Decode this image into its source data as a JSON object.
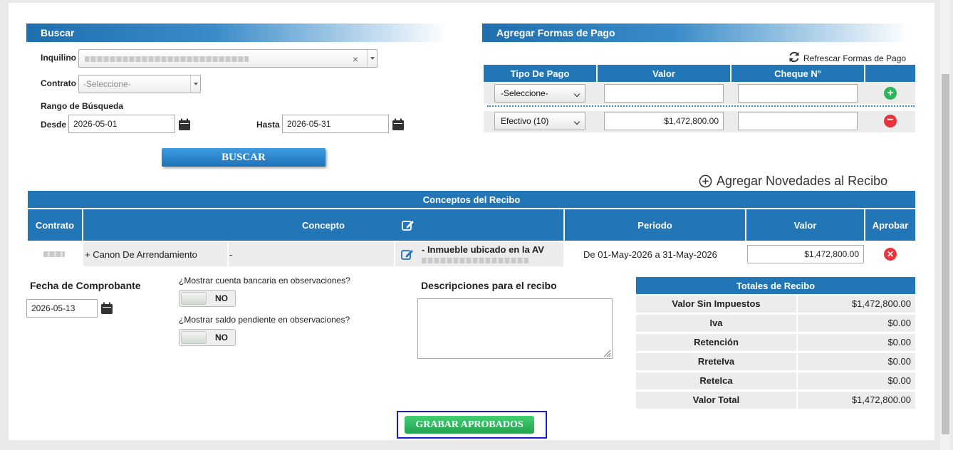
{
  "buscar": {
    "title": "Buscar",
    "inquilino_label": "Inquilino",
    "contrato_label": "Contrato",
    "contrato_placeholder": "-Seleccione-",
    "rango_label": "Rango de Búsqueda",
    "desde_label": "Desde",
    "desde_value": "2026-05-01",
    "hasta_label": "Hasta",
    "hasta_value": "2026-05-31",
    "button": "BUSCAR"
  },
  "pagos": {
    "title": "Agregar Formas de Pago",
    "refresh": "Refrescar Formas de Pago",
    "headers": [
      "Tipo De Pago",
      "Valor",
      "Cheque N°"
    ],
    "new_row_select": "-Seleccione-",
    "row": {
      "tipo": "Efectivo (10)",
      "valor": "$1,472,800.00",
      "cheque": ""
    }
  },
  "novedades": {
    "label": "Agregar Novedades al Recibo"
  },
  "conceptos": {
    "title": "Conceptos del Recibo",
    "headers": {
      "contrato": "Contrato",
      "concepto": "Concepto",
      "periodo": "Periodo",
      "valor": "Valor",
      "aprobar": "Aprobar"
    },
    "row": {
      "concepto": "+ Canon De Arrendamiento",
      "detalle": "-",
      "descripcion": "- Inmueble ubicado en la AV",
      "periodo": "De 01-May-2026 a 31-May-2026",
      "valor": "$1,472,800.00"
    }
  },
  "comprobante": {
    "label": "Fecha de Comprobante",
    "value": "2026-05-13"
  },
  "toggles": [
    {
      "question": "¿Mostrar cuenta bancaria en observaciones?",
      "state": "NO"
    },
    {
      "question": "¿Mostrar saldo pendiente en observaciones?",
      "state": "NO"
    }
  ],
  "descripciones": {
    "label": "Descripciones para el recibo",
    "value": ""
  },
  "totales": {
    "title": "Totales de Recibo",
    "rows": [
      {
        "label": "Valor Sin Impuestos",
        "value": "$1,472,800.00"
      },
      {
        "label": "Iva",
        "value": "$0.00"
      },
      {
        "label": "Retención",
        "value": "$0.00"
      },
      {
        "label": "RreteIva",
        "value": "$0.00"
      },
      {
        "label": "ReteIca",
        "value": "$0.00"
      },
      {
        "label": "Valor Total",
        "value": "$1,472,800.00"
      }
    ]
  },
  "grabar": {
    "label": "GRABAR APROBADOS"
  },
  "colors": {
    "header_blue": "#2276b6",
    "accent_green": "#2fb55c",
    "danger_red": "#e8343c"
  }
}
